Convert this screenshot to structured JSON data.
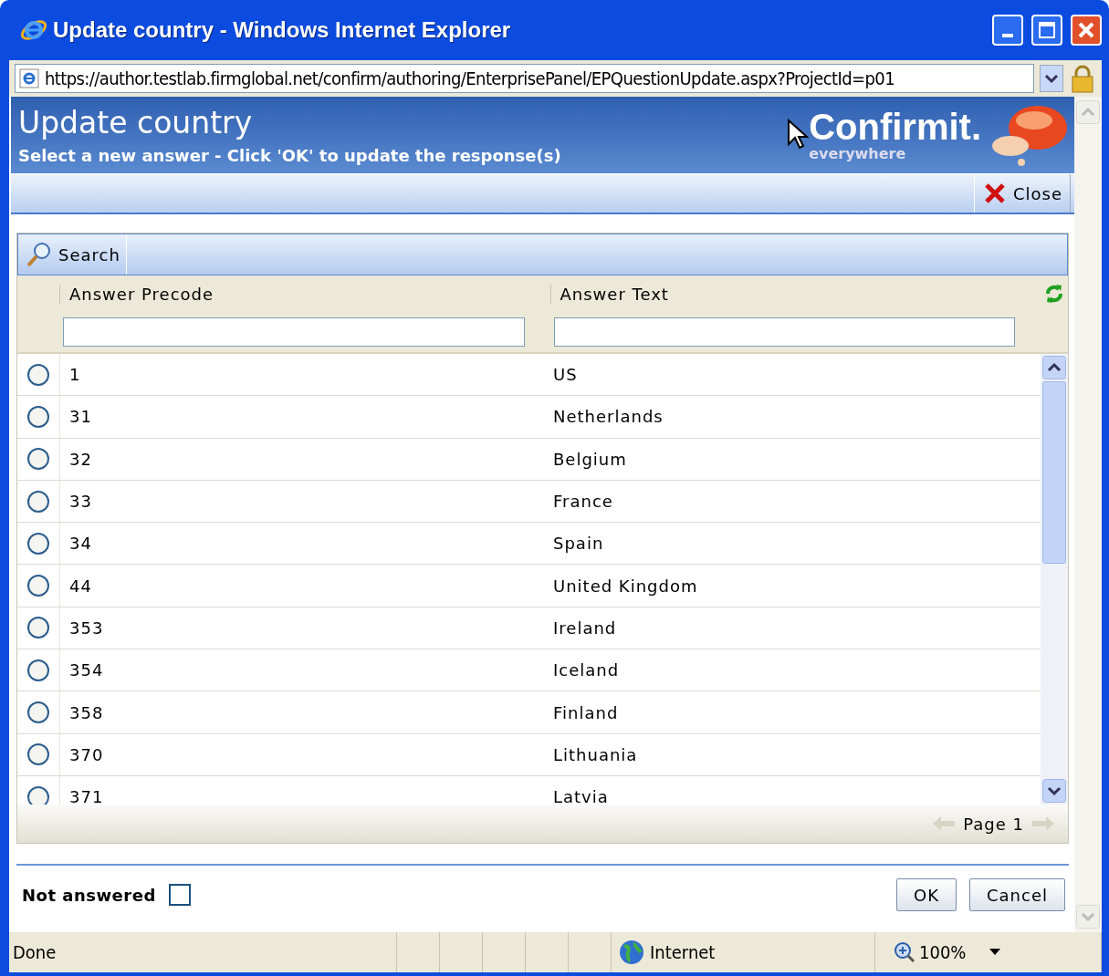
{
  "window": {
    "title": "Update country - Windows Internet Explorer"
  },
  "address_bar": {
    "url": "https://author.testlab.firmglobal.net/confirm/authoring/EnterprisePanel/EPQuestionUpdate.aspx?ProjectId=p01"
  },
  "header": {
    "title": "Update country",
    "subtitle": "Select a new answer - Click 'OK' to update the response(s)",
    "logo": "Confirmit.",
    "tagline": "everywhere"
  },
  "toolbar": {
    "close": "Close"
  },
  "search": {
    "label": "Search"
  },
  "table": {
    "columns": [
      "Answer Precode",
      "Answer Text"
    ],
    "rows": [
      {
        "precode": "1",
        "text": "US",
        "selected": false
      },
      {
        "precode": "31",
        "text": "Netherlands",
        "selected": false
      },
      {
        "precode": "32",
        "text": "Belgium",
        "selected": false
      },
      {
        "precode": "33",
        "text": "France",
        "selected": false
      },
      {
        "precode": "34",
        "text": "Spain",
        "selected": false
      },
      {
        "precode": "44",
        "text": "United Kingdom",
        "selected": false
      },
      {
        "precode": "353",
        "text": "Ireland",
        "selected": false
      },
      {
        "precode": "354",
        "text": "Iceland",
        "selected": false
      },
      {
        "precode": "358",
        "text": "Finland",
        "selected": false
      },
      {
        "precode": "370",
        "text": "Lithuania",
        "selected": false
      },
      {
        "precode": "371",
        "text": "Latvia",
        "selected": false
      }
    ]
  },
  "pager": {
    "label": "Page 1"
  },
  "footer": {
    "not_answered": {
      "label": "Not answered",
      "checked": false
    },
    "buttons": [
      "OK",
      "Cancel"
    ]
  },
  "status_bar": {
    "status": "Done",
    "zone": "Internet",
    "zoom": "100%"
  }
}
